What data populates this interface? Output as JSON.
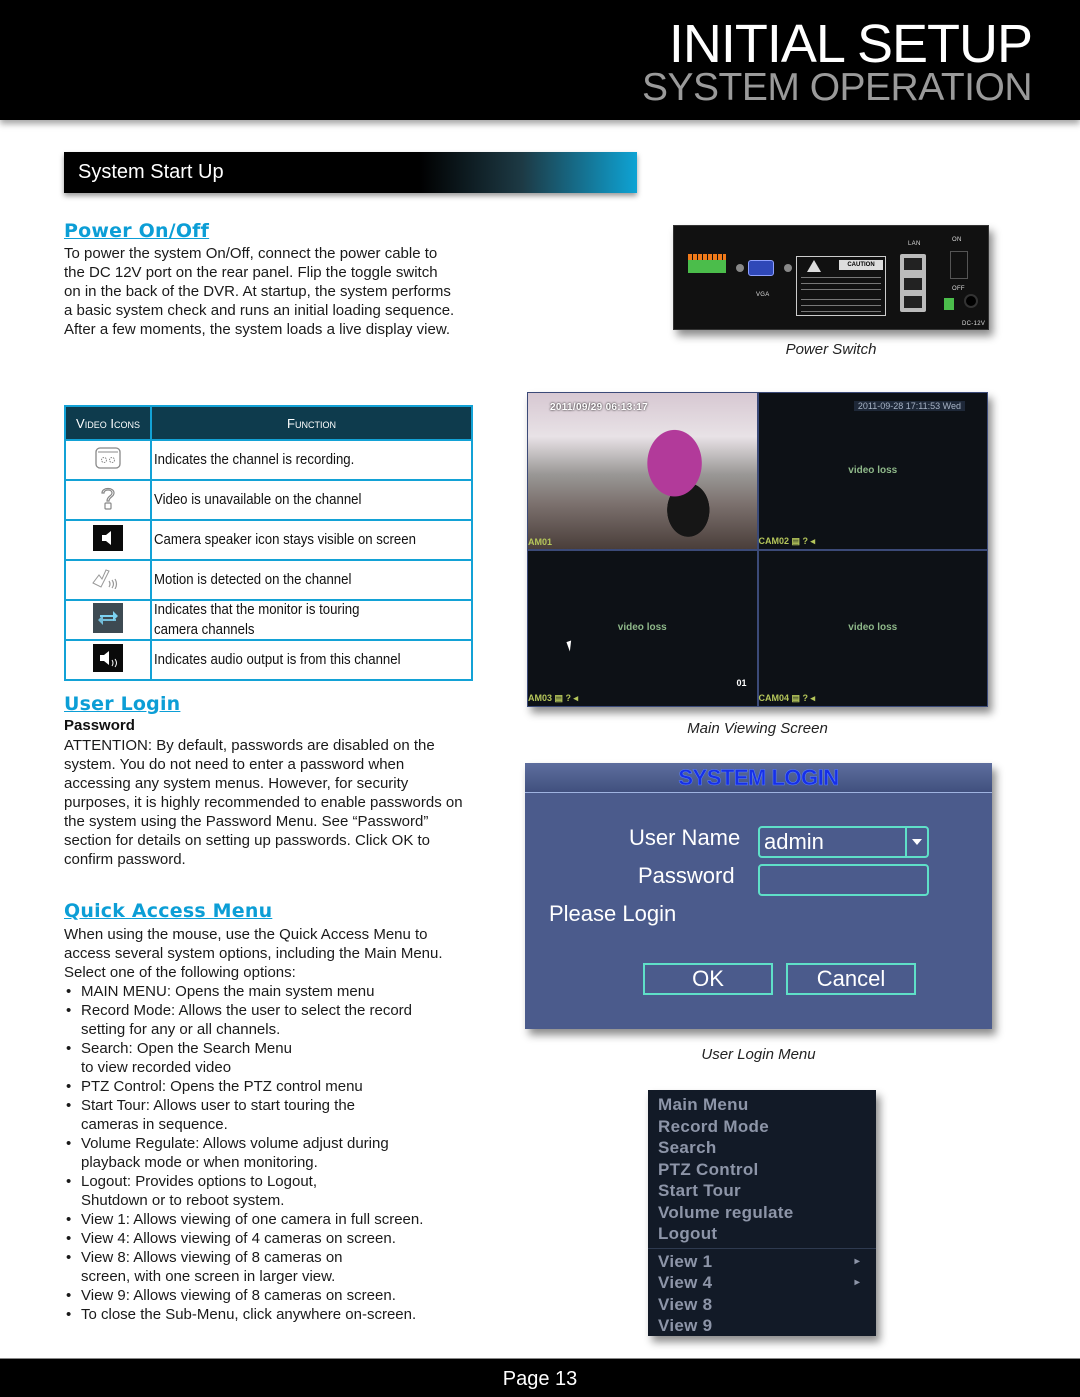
{
  "header": {
    "title": "INITIAL SETUP",
    "subtitle": "SYSTEM OPERATION"
  },
  "section_bar": {
    "label": "System Start Up"
  },
  "power": {
    "heading": "Power On/Off",
    "body": "To power the system On/Off, connect the power cable to the DC 12V port on the rear panel. Flip the toggle switch on in the back of the DVR. At startup, the system performs a basic system check and runs an initial loading sequence. After a few moments, the system loads a live display view."
  },
  "icon_table": {
    "headers": [
      "Video Icons",
      "Function"
    ],
    "rows": [
      {
        "icon": "recording-icon",
        "text": "Indicates the channel is recording."
      },
      {
        "icon": "question-mark-icon",
        "text": "Video is unavailable on the channel"
      },
      {
        "icon": "speaker-icon",
        "text": "Camera speaker icon stays visible on screen"
      },
      {
        "icon": "motion-icon",
        "text": "Motion is detected on the channel"
      },
      {
        "icon": "tour-cycle-icon",
        "text": "Indicates that the monitor is touring\ncamera channels"
      },
      {
        "icon": "audio-output-icon",
        "text": "Indicates audio output is from this channel"
      }
    ]
  },
  "user_login": {
    "heading": "User Login",
    "subheading": "Password",
    "body": "ATTENTION: By default, passwords are disabled on the system. You do not need to enter a password when accessing any system menus. However, for security purposes, it is highly recommended to enable passwords on the system using the Password Menu. See “Password” section for details on setting up passwords. Click OK to confirm password."
  },
  "quick_access": {
    "heading": "Quick Access Menu",
    "intro": "When using the mouse, use the Quick Access Menu to access several system options, including the Main Menu. Select one of the following options:",
    "bullets": [
      "MAIN MENU: Opens the main system menu",
      "Record Mode: Allows the user to select the record setting for any or all channels.",
      "Search: Open the Search Menu\nto view recorded video",
      "PTZ Control: Opens the PTZ control menu",
      "Start Tour: Allows user to start touring the cameras in sequence.",
      "Volume Regulate: Allows volume adjust during playback mode or when monitoring.",
      "Logout: Provides options to Logout, Shutdown or to reboot system.",
      "View 1: Allows viewing of one camera in full screen.",
      "View 4: Allows viewing of 4 cameras on screen.",
      "View 8: Allows viewing of 8 cameras on\nscreen, with one screen in larger view.",
      "View 9: Allows viewing of 8 cameras on screen.",
      "To close the Sub-Menu, click anywhere on-screen."
    ]
  },
  "dvr_panel": {
    "caption": "Power Switch",
    "labels": {
      "vga": "VGA",
      "lan": "LAN",
      "on": "ON",
      "off": "OFF",
      "dc": "DC-12V",
      "caution": "CAUTION"
    }
  },
  "main_view": {
    "caption": "Main Viewing Screen",
    "timestamp_cam1": "2011/09/29  06:13:17",
    "timestamp_global": "2011-09-28 17:11:53 Wed",
    "video_loss": "video loss",
    "channel_number": "01",
    "cameras": [
      "AM01",
      "CAM02",
      "AM03",
      "CAM04"
    ],
    "status_suffix": " ▤ ? ◂"
  },
  "login_dialog": {
    "caption": "User Login Menu",
    "title": "SYSTEM LOGIN",
    "user_name_label": "User Name",
    "user_name_value": "admin",
    "password_label": "Password",
    "password_value": "",
    "prompt": "Please Login",
    "ok": "OK",
    "cancel": "Cancel"
  },
  "quick_menu": {
    "items": [
      "Main Menu",
      "Record Mode",
      "Search",
      "PTZ Control",
      "Start Tour",
      "Volume regulate",
      "Logout"
    ],
    "view_items": [
      {
        "label": "View 1",
        "has_submenu": true
      },
      {
        "label": "View 4",
        "has_submenu": true
      },
      {
        "label": "View 8",
        "has_submenu": false
      },
      {
        "label": "View 9",
        "has_submenu": false
      }
    ],
    "submenu_arrow": "▸"
  },
  "footer": {
    "page_label": "Page  13"
  }
}
